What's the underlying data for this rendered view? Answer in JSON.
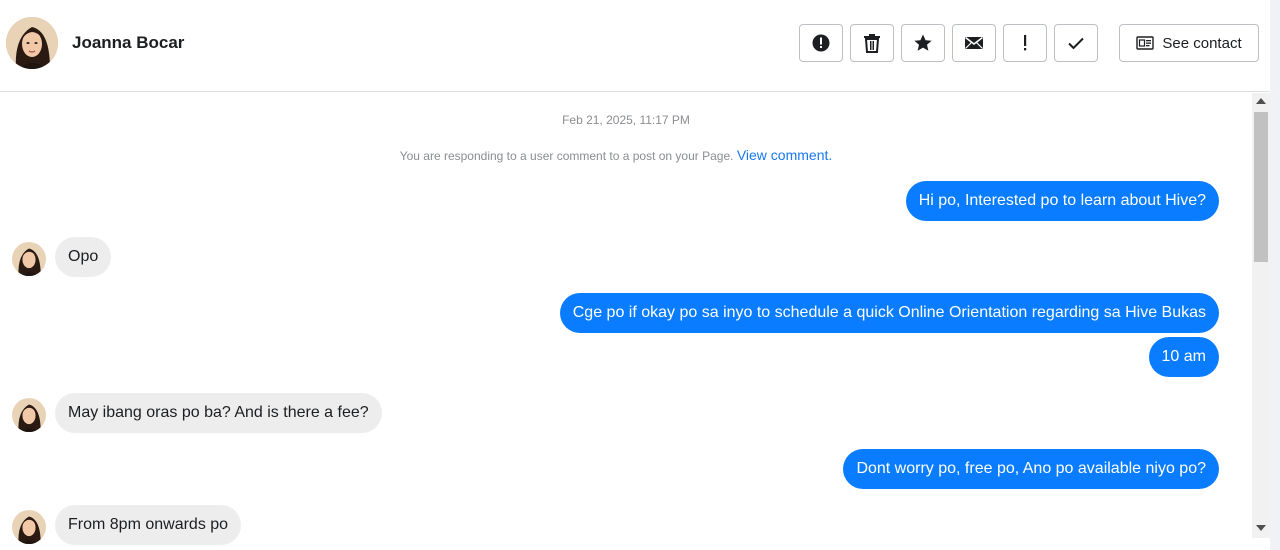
{
  "contact": {
    "name": "Joanna Bocar"
  },
  "toolbar": {
    "buttons": [
      {
        "icon": "alert-circle-icon"
      },
      {
        "icon": "trash-icon"
      },
      {
        "icon": "star-icon"
      },
      {
        "icon": "envelope-icon"
      },
      {
        "icon": "exclamation-icon"
      },
      {
        "icon": "check-icon"
      }
    ],
    "see_contact_label": "See contact"
  },
  "conversation": {
    "timestamp": "Feb 21, 2025, 11:17 PM",
    "context_text": "You are responding to a user comment to a post on your Page.",
    "context_link": "View comment.",
    "messages": [
      {
        "direction": "outgoing",
        "text": "Hi po, Interested po to learn about Hive?"
      },
      {
        "direction": "incoming",
        "text": "Opo"
      },
      {
        "direction": "outgoing",
        "text": "Cge po if okay po sa inyo to schedule a quick Online Orientation regarding sa Hive Bukas"
      },
      {
        "direction": "outgoing",
        "text": "10 am"
      },
      {
        "direction": "incoming",
        "text": "May ibang oras po ba? And is there a fee?"
      },
      {
        "direction": "outgoing",
        "text": "Dont worry po, free po, Ano po available niyo po?"
      },
      {
        "direction": "incoming",
        "text": "From 8pm onwards po"
      }
    ]
  },
  "colors": {
    "outgoing_bubble": "#0a7cff",
    "incoming_bubble": "#ededed",
    "link": "#1877f2"
  }
}
